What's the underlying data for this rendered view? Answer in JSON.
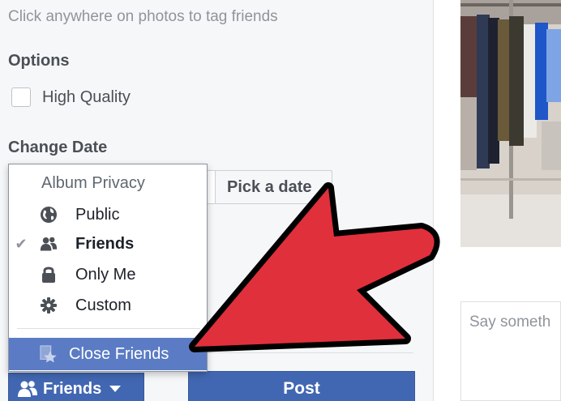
{
  "composer": {
    "hint": "Click anywhere on photos to tag friends",
    "options_title": "Options",
    "high_quality_label": "High Quality",
    "change_date_title": "Change Date",
    "pick_date_label": "Pick a date",
    "post_label": "Post"
  },
  "privacy_button": {
    "label": "Friends",
    "icon": "friends-icon"
  },
  "privacy_menu": {
    "header": "Album Privacy",
    "items": [
      {
        "label": "Public",
        "icon": "globe-icon",
        "selected": false
      },
      {
        "label": "Friends",
        "icon": "friends-icon",
        "selected": true
      },
      {
        "label": "Only Me",
        "icon": "lock-icon",
        "selected": false
      },
      {
        "label": "Custom",
        "icon": "gear-icon",
        "selected": false
      },
      {
        "label": "Close Friends",
        "icon": "star-list-icon",
        "selected": false,
        "highlighted": true
      }
    ],
    "checkmark": "✔"
  },
  "comment": {
    "placeholder": "Say someth"
  },
  "colors": {
    "facebook_blue": "#4267b2",
    "highlight": "#5b7cc4",
    "arrow_red": "#e0303c"
  }
}
